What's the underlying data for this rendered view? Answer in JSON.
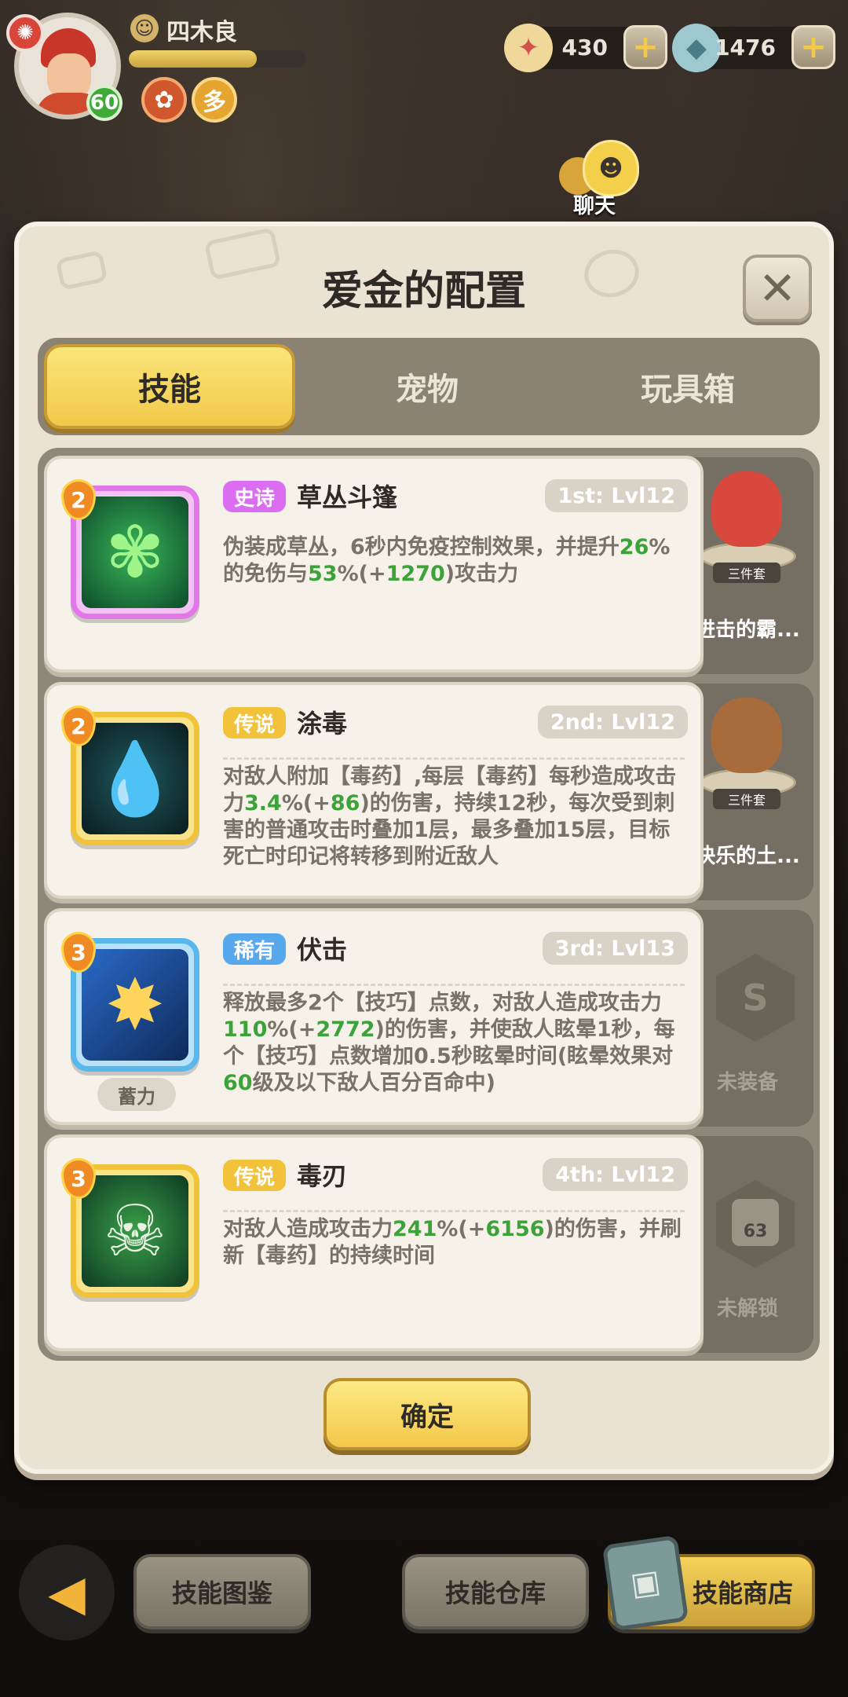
{
  "player": {
    "name": "四木良",
    "level": "60",
    "exp_fraction": 0.72
  },
  "currencies": [
    {
      "name": "shell-stars",
      "value": "430"
    },
    {
      "name": "gems",
      "value": "1476"
    }
  ],
  "chat": {
    "label": "聊天"
  },
  "panel": {
    "title": "爱金的配置",
    "tabs": [
      {
        "label": "技能",
        "active": true
      },
      {
        "label": "宠物",
        "active": false
      },
      {
        "label": "玩具箱",
        "active": false
      }
    ],
    "skills": [
      {
        "count": "2",
        "rarity": "史诗",
        "name": "草丛斗篷",
        "slot": "1st: Lvl12",
        "icon": "leaf-cloak-icon",
        "desc": [
          "伪装成草丛，6秒内免疫控制效果，并提升",
          "26",
          "%",
          "的免伤与",
          "53",
          "%(+",
          "1270",
          ")攻击力"
        ]
      },
      {
        "count": "2",
        "rarity": "传说",
        "name": "涂毒",
        "slot": "2nd: Lvl12",
        "icon": "poison-drop-icon",
        "desc": [
          "对敌人附加【毒药】,每层【毒药】每秒造成攻击力",
          "3.4",
          "%(+",
          "86",
          ")的伤害，持续12秒，每次受到刺害的普通攻击时叠加1层，最多叠加15层，目标死亡时印记将转移到附近敌人"
        ]
      },
      {
        "count": "3",
        "rarity": "稀有",
        "name": "伏击",
        "slot": "3rd: Lvl13",
        "icon": "ambush-icon",
        "tag": "蓄力",
        "desc": [
          "释放最多2个【技巧】点数，对敌人造成攻击力",
          "110",
          "%(+",
          "2772",
          ")的伤害，并使敌人眩晕1秒，每个【技巧】点数增加0.5秒眩晕时间(眩晕效果对",
          "60",
          "级及以下敌人百分百命中)"
        ]
      },
      {
        "count": "3",
        "rarity": "传说",
        "name": "毒刃",
        "slot": "4th: Lvl12",
        "icon": "poison-skull-icon",
        "desc": [
          "对敌人造成攻击力",
          "241",
          "%(+",
          "6156",
          ")的伤害，并刷新【毒药】的持续时间"
        ]
      }
    ],
    "pets": [
      {
        "label": "进击的霸...",
        "tag": "三件套"
      },
      {
        "label": "快乐的土...",
        "tag": "三件套"
      },
      {
        "label": "未装备"
      },
      {
        "label": "未解锁",
        "lock_level": "63"
      }
    ],
    "confirm": "确定"
  },
  "bottom": {
    "skill_atlas": "技能图鉴",
    "skill_storage": "技能仓库",
    "skill_shop": "技能商店"
  }
}
